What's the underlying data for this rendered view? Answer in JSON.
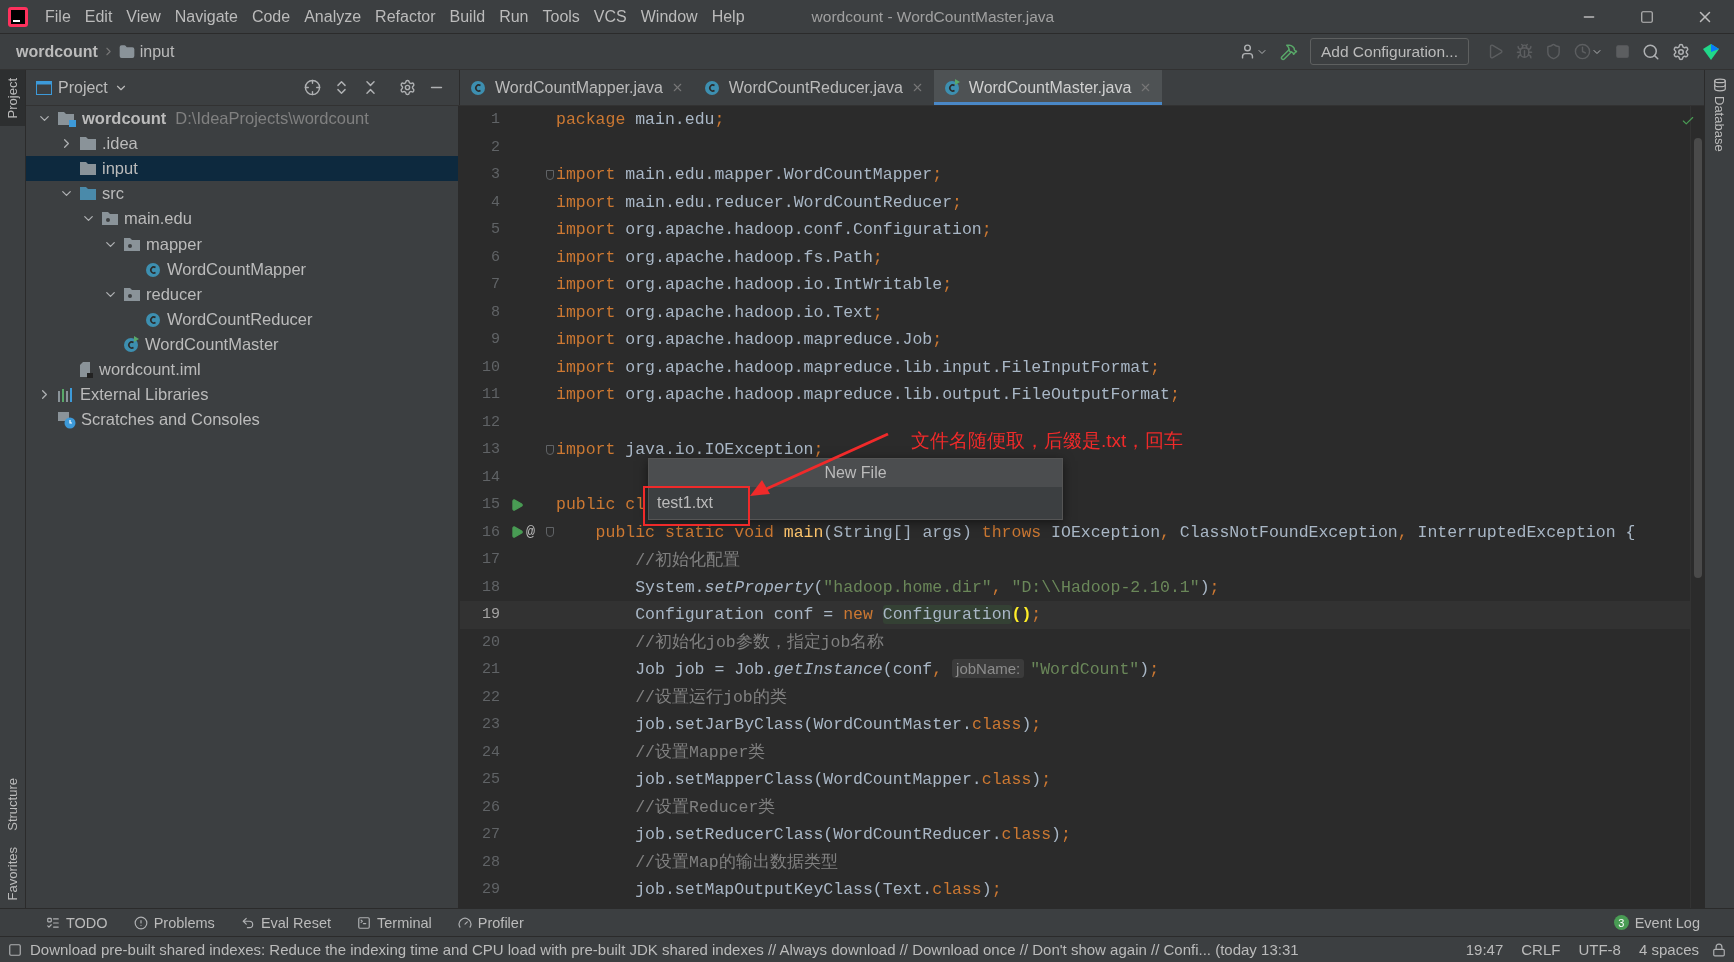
{
  "window": {
    "menu": [
      "File",
      "Edit",
      "View",
      "Navigate",
      "Code",
      "Analyze",
      "Refactor",
      "Build",
      "Run",
      "Tools",
      "VCS",
      "Window",
      "Help"
    ],
    "title": "wordcount - WordCountMaster.java"
  },
  "navbar": {
    "breadcrumbs": [
      {
        "label": "wordcount",
        "kind": "project"
      },
      {
        "label": "input",
        "kind": "folder"
      }
    ],
    "run_config": "Add Configuration..."
  },
  "left_stripe": {
    "top": [
      {
        "label": "Project",
        "selected": true
      }
    ],
    "bottom": [
      {
        "label": "Structure",
        "selected": false
      },
      {
        "label": "Favorites",
        "selected": false
      }
    ]
  },
  "right_stripe": [
    {
      "label": "Database",
      "selected": false
    }
  ],
  "project": {
    "title": "Project",
    "tree": [
      {
        "label": "wordcount",
        "kind": "module",
        "path": "D:\\IdeaProjects\\wordcount",
        "expanded": true,
        "selected": false,
        "children": [
          {
            "label": ".idea",
            "kind": "folder",
            "expanded": false,
            "selected": false
          },
          {
            "label": "input",
            "kind": "folder",
            "selected": true
          },
          {
            "label": "src",
            "kind": "source",
            "expanded": true,
            "selected": false,
            "children": [
              {
                "label": "main.edu",
                "kind": "package",
                "expanded": true,
                "selected": false,
                "children": [
                  {
                    "label": "mapper",
                    "kind": "package",
                    "expanded": true,
                    "selected": false,
                    "children": [
                      {
                        "label": "WordCountMapper",
                        "kind": "class",
                        "selected": false
                      }
                    ]
                  },
                  {
                    "label": "reducer",
                    "kind": "package",
                    "expanded": true,
                    "selected": false,
                    "children": [
                      {
                        "label": "WordCountReducer",
                        "kind": "class",
                        "selected": false
                      }
                    ]
                  },
                  {
                    "label": "WordCountMaster",
                    "kind": "main-class",
                    "selected": false
                  }
                ]
              }
            ]
          },
          {
            "label": "wordcount.iml",
            "kind": "iml",
            "selected": false
          }
        ]
      },
      {
        "label": "External Libraries",
        "kind": "libraries",
        "expanded": false,
        "selected": false
      },
      {
        "label": "Scratches and Consoles",
        "kind": "scratches",
        "selected": false
      }
    ]
  },
  "tabs": [
    {
      "label": "WordCountMapper.java",
      "kind": "class",
      "selected": false
    },
    {
      "label": "WordCountReducer.java",
      "kind": "class",
      "selected": false
    },
    {
      "label": "WordCountMaster.java",
      "kind": "main-class",
      "selected": true
    }
  ],
  "editor": {
    "lines": [
      {
        "number": "1",
        "current": false,
        "run": false,
        "fold": false,
        "segments": [
          {
            "kind": "kw",
            "text": "package "
          },
          {
            "kind": "plain",
            "text": "main.edu"
          },
          {
            "kind": "kw",
            "text": ";"
          }
        ]
      },
      {
        "number": "2",
        "current": false,
        "run": false,
        "fold": false
      },
      {
        "number": "3",
        "current": false,
        "run": false,
        "fold": true,
        "segments": [
          {
            "kind": "kw",
            "text": "import "
          },
          {
            "kind": "plain",
            "text": "main.edu.mapper.WordCountMapper"
          },
          {
            "kind": "kw",
            "text": ";"
          }
        ]
      },
      {
        "number": "4",
        "current": false,
        "run": false,
        "fold": false,
        "segments": [
          {
            "kind": "kw",
            "text": "import "
          },
          {
            "kind": "plain",
            "text": "main.edu.reducer.WordCountReducer"
          },
          {
            "kind": "kw",
            "text": ";"
          }
        ]
      },
      {
        "number": "5",
        "current": false,
        "run": false,
        "fold": false,
        "segments": [
          {
            "kind": "kw",
            "text": "import "
          },
          {
            "kind": "plain",
            "text": "org.apache.hadoop.conf.Configuration"
          },
          {
            "kind": "kw",
            "text": ";"
          }
        ]
      },
      {
        "number": "6",
        "current": false,
        "run": false,
        "fold": false,
        "segments": [
          {
            "kind": "kw",
            "text": "import "
          },
          {
            "kind": "plain",
            "text": "org.apache.hadoop.fs.Path"
          },
          {
            "kind": "kw",
            "text": ";"
          }
        ]
      },
      {
        "number": "7",
        "current": false,
        "run": false,
        "fold": false,
        "segments": [
          {
            "kind": "kw",
            "text": "import "
          },
          {
            "kind": "plain",
            "text": "org.apache.hadoop.io.IntWritable"
          },
          {
            "kind": "kw",
            "text": ";"
          }
        ]
      },
      {
        "number": "8",
        "current": false,
        "run": false,
        "fold": false,
        "segments": [
          {
            "kind": "kw",
            "text": "import "
          },
          {
            "kind": "plain",
            "text": "org.apache.hadoop.io.Text"
          },
          {
            "kind": "kw",
            "text": ";"
          }
        ]
      },
      {
        "number": "9",
        "current": false,
        "run": false,
        "fold": false,
        "segments": [
          {
            "kind": "kw",
            "text": "import "
          },
          {
            "kind": "plain",
            "text": "org.apache.hadoop.mapreduce.Job"
          },
          {
            "kind": "kw",
            "text": ";"
          }
        ]
      },
      {
        "number": "10",
        "current": false,
        "run": false,
        "fold": false,
        "segments": [
          {
            "kind": "kw",
            "text": "import "
          },
          {
            "kind": "plain",
            "text": "org.apache.hadoop.mapreduce.lib.input.FileInputFormat"
          },
          {
            "kind": "kw",
            "text": ";"
          }
        ]
      },
      {
        "number": "11",
        "current": false,
        "run": false,
        "fold": false,
        "segments": [
          {
            "kind": "kw",
            "text": "import "
          },
          {
            "kind": "plain",
            "text": "org.apache.hadoop.mapreduce.lib.output.FileOutputFormat"
          },
          {
            "kind": "kw",
            "text": ";"
          }
        ]
      },
      {
        "number": "12",
        "current": false,
        "run": false,
        "fold": false
      },
      {
        "number": "13",
        "current": false,
        "run": false,
        "fold": true,
        "segments": [
          {
            "kind": "kw",
            "text": "import "
          },
          {
            "kind": "plain",
            "text": "java.io.IOException"
          },
          {
            "kind": "kw",
            "text": ";"
          }
        ]
      },
      {
        "number": "14",
        "current": false,
        "run": false,
        "fold": false
      },
      {
        "number": "15",
        "current": false,
        "run": true,
        "fold": false,
        "segments": [
          {
            "kind": "kw",
            "text": "public cl"
          }
        ]
      },
      {
        "number": "16",
        "current": false,
        "run": true,
        "marker": "@",
        "fold": true,
        "segments": [
          {
            "kind": "kw",
            "text": "    public static void "
          },
          {
            "kind": "fn",
            "text": "main"
          },
          {
            "kind": "plain",
            "text": "(String[] args) "
          },
          {
            "kind": "kw",
            "text": "throws "
          },
          {
            "kind": "plain",
            "text": "IOException"
          },
          {
            "kind": "kw",
            "text": ", "
          },
          {
            "kind": "plain",
            "text": "ClassNotFoundException"
          },
          {
            "kind": "kw",
            "text": ", "
          },
          {
            "kind": "plain",
            "text": "InterruptedException {"
          }
        ]
      },
      {
        "number": "17",
        "current": false,
        "run": false,
        "fold": false,
        "segments": [
          {
            "kind": "comment",
            "text": "        //初始化配置"
          }
        ]
      },
      {
        "number": "18",
        "current": false,
        "run": false,
        "fold": false,
        "segments": [
          {
            "kind": "plain",
            "text": "        System."
          },
          {
            "kind": "static",
            "text": "setProperty"
          },
          {
            "kind": "plain",
            "text": "("
          },
          {
            "kind": "str",
            "text": "\"hadoop.home.dir\""
          },
          {
            "kind": "kw",
            "text": ", "
          },
          {
            "kind": "str",
            "text": "\"D:\\\\Hadoop-2.10.1\""
          },
          {
            "kind": "plain",
            "text": ")"
          },
          {
            "kind": "kw",
            "text": ";"
          }
        ]
      },
      {
        "number": "19",
        "current": true,
        "run": false,
        "fold": false,
        "segments": [
          {
            "kind": "plain",
            "text": "        Configuration conf = "
          },
          {
            "kind": "kw",
            "text": "new "
          },
          {
            "kind": "usage",
            "text": "Configuration"
          },
          {
            "kind": "brace",
            "text": "()"
          },
          {
            "kind": "kw",
            "text": ";"
          }
        ]
      },
      {
        "number": "20",
        "current": false,
        "run": false,
        "fold": false,
        "segments": [
          {
            "kind": "comment",
            "text": "        //初始化job参数，指定job名称"
          }
        ]
      },
      {
        "number": "21",
        "current": false,
        "run": false,
        "fold": false,
        "segments": [
          {
            "kind": "plain",
            "text": "        Job job = Job."
          },
          {
            "kind": "static",
            "text": "getInstance"
          },
          {
            "kind": "plain",
            "text": "(conf"
          },
          {
            "kind": "kw",
            "text": ", "
          },
          {
            "kind": "hint",
            "text": "jobName:"
          },
          {
            "kind": "str",
            "text": "\"WordCount\""
          },
          {
            "kind": "plain",
            "text": ")"
          },
          {
            "kind": "kw",
            "text": ";"
          }
        ]
      },
      {
        "number": "22",
        "current": false,
        "run": false,
        "fold": false,
        "segments": [
          {
            "kind": "comment",
            "text": "        //设置运行job的类"
          }
        ]
      },
      {
        "number": "23",
        "current": false,
        "run": false,
        "fold": false,
        "segments": [
          {
            "kind": "plain",
            "text": "        job.setJarByClass(WordCountMaster."
          },
          {
            "kind": "kw",
            "text": "class"
          },
          {
            "kind": "plain",
            "text": ")"
          },
          {
            "kind": "kw",
            "text": ";"
          }
        ]
      },
      {
        "number": "24",
        "current": false,
        "run": false,
        "fold": false,
        "segments": [
          {
            "kind": "comment",
            "text": "        //设置Mapper类"
          }
        ]
      },
      {
        "number": "25",
        "current": false,
        "run": false,
        "fold": false,
        "segments": [
          {
            "kind": "plain",
            "text": "        job.setMapperClass(WordCountMapper."
          },
          {
            "kind": "kw",
            "text": "class"
          },
          {
            "kind": "plain",
            "text": ")"
          },
          {
            "kind": "kw",
            "text": ";"
          }
        ]
      },
      {
        "number": "26",
        "current": false,
        "run": false,
        "fold": false,
        "segments": [
          {
            "kind": "comment",
            "text": "        //设置Reducer类"
          }
        ]
      },
      {
        "number": "27",
        "current": false,
        "run": false,
        "fold": false,
        "segments": [
          {
            "kind": "plain",
            "text": "        job.setReducerClass(WordCountReducer."
          },
          {
            "kind": "kw",
            "text": "class"
          },
          {
            "kind": "plain",
            "text": ")"
          },
          {
            "kind": "kw",
            "text": ";"
          }
        ]
      },
      {
        "number": "28",
        "current": false,
        "run": false,
        "fold": false,
        "segments": [
          {
            "kind": "comment",
            "text": "        //设置Map的输出数据类型"
          }
        ]
      },
      {
        "number": "29",
        "current": false,
        "run": false,
        "fold": false,
        "segments": [
          {
            "kind": "plain",
            "text": "        job.setMapOutputKeyClass(Text."
          },
          {
            "kind": "kw",
            "text": "class"
          },
          {
            "kind": "plain",
            "text": ")"
          },
          {
            "kind": "kw",
            "text": ";"
          }
        ]
      }
    ]
  },
  "new_file_popup": {
    "title": "New File",
    "value": "test1.txt"
  },
  "annotation": {
    "text": "文件名随便取，后缀是.txt，回车"
  },
  "tool_windows": [
    {
      "label": "TODO",
      "kind": "todo"
    },
    {
      "label": "Problems",
      "kind": "problems"
    },
    {
      "label": "Eval Reset",
      "kind": "reset"
    },
    {
      "label": "Terminal",
      "kind": "terminal"
    },
    {
      "label": "Profiler",
      "kind": "profiler"
    }
  ],
  "event_log": {
    "count": "3",
    "label": "Event Log"
  },
  "status_bar": {
    "message": "Download pre-built shared indexes: Reduce the indexing time and CPU load with pre-built JDK shared indexes // Always download // Download once // Don't show again // Confi... (today 13:31",
    "items": [
      "19:47",
      "CRLF",
      "UTF-8",
      "4 spaces"
    ]
  }
}
